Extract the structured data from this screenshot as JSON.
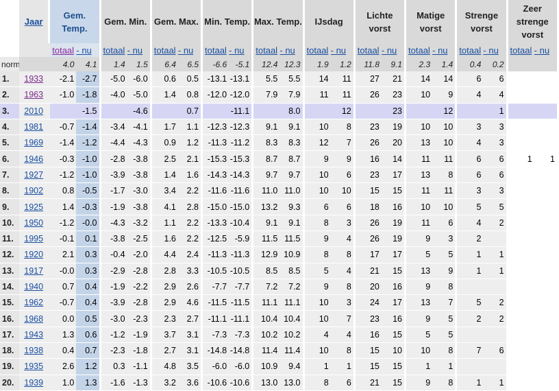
{
  "headers": {
    "jaar": "Jaar",
    "gem_temp": "Gem. Temp.",
    "gem_min": "Gem. Min.",
    "gem_max": "Gem. Max.",
    "min_temp": "Min. Temp.",
    "max_temp": "Max. Temp.",
    "ijsdag": "IJsdag",
    "lichte_vorst": "Lichte vorst",
    "matige_vorst": "Matige vorst",
    "strenge_vorst": "Strenge vorst",
    "zeer_strenge_vorst": "Zeer strenge vorst"
  },
  "subheaders": {
    "totaal": "totaal",
    "nu": "- nu"
  },
  "norm": {
    "label": "norm.",
    "values": [
      "4.0",
      "4.1",
      "1.4",
      "1.5",
      "6.4",
      "6.5",
      "-6.6",
      "-5.1",
      "12.4",
      "12.3",
      "1.9",
      "1.2",
      "11.8",
      "9.1",
      "2.3",
      "1.4",
      "0.4",
      "0.2",
      "",
      ""
    ]
  },
  "rows": [
    {
      "rank": "1.",
      "year": "1933",
      "values": [
        "-2.1",
        "-2.7",
        "-5.0",
        "-6.0",
        "0.6",
        "0.5",
        "-13.1",
        "-13.1",
        "5.5",
        "5.5",
        "14",
        "11",
        "27",
        "21",
        "14",
        "14",
        "6",
        "6",
        "",
        ""
      ]
    },
    {
      "rank": "2.",
      "year": "1963",
      "values": [
        "-1.0",
        "-1.8",
        "-4.0",
        "-5.0",
        "1.4",
        "0.8",
        "-12.0",
        "-12.0",
        "7.9",
        "7.9",
        "11",
        "11",
        "26",
        "23",
        "10",
        "9",
        "4",
        "4",
        "",
        ""
      ]
    },
    {
      "rank": "3.",
      "year": "2010",
      "current": true,
      "values": [
        "",
        "-1.5",
        "",
        "-4.6",
        "",
        "0.7",
        "",
        "-11.1",
        "",
        "8.0",
        "",
        "12",
        "",
        "23",
        "",
        "12",
        "",
        "1",
        "",
        ""
      ]
    },
    {
      "rank": "4.",
      "year": "1981",
      "values": [
        "-0.7",
        "-1.4",
        "-3.4",
        "-4.1",
        "1.7",
        "1.1",
        "-12.3",
        "-12.3",
        "9.1",
        "9.1",
        "10",
        "8",
        "23",
        "19",
        "10",
        "10",
        "3",
        "3",
        "",
        ""
      ]
    },
    {
      "rank": "5.",
      "year": "1969",
      "values": [
        "-1.4",
        "-1.2",
        "-4.4",
        "-4.3",
        "0.9",
        "1.2",
        "-11.3",
        "-11.2",
        "8.3",
        "8.3",
        "12",
        "7",
        "26",
        "20",
        "13",
        "10",
        "4",
        "3",
        "",
        ""
      ]
    },
    {
      "rank": "6.",
      "year": "1946",
      "values": [
        "-0.3",
        "-1.0",
        "-2.8",
        "-3.8",
        "2.5",
        "2.1",
        "-15.3",
        "-15.3",
        "8.7",
        "8.7",
        "9",
        "9",
        "16",
        "14",
        "11",
        "11",
        "6",
        "6",
        "1",
        "1"
      ]
    },
    {
      "rank": "7.",
      "year": "1927",
      "values": [
        "-1.2",
        "-1.0",
        "-3.9",
        "-3.8",
        "1.4",
        "1.6",
        "-14.3",
        "-14.3",
        "9.7",
        "9.7",
        "10",
        "6",
        "23",
        "17",
        "13",
        "8",
        "6",
        "6",
        "",
        ""
      ]
    },
    {
      "rank": "8.",
      "year": "1902",
      "values": [
        "0.8",
        "-0.5",
        "-1.7",
        "-3.0",
        "3.4",
        "2.2",
        "-11.6",
        "-11.6",
        "11.0",
        "11.0",
        "10",
        "10",
        "15",
        "15",
        "11",
        "11",
        "3",
        "3",
        "",
        ""
      ]
    },
    {
      "rank": "9.",
      "year": "1925",
      "values": [
        "1.4",
        "-0.3",
        "-1.9",
        "-3.8",
        "4.1",
        "2.8",
        "-15.0",
        "-15.0",
        "13.2",
        "9.3",
        "6",
        "6",
        "18",
        "16",
        "10",
        "10",
        "5",
        "5",
        "",
        ""
      ]
    },
    {
      "rank": "10.",
      "year": "1950",
      "values": [
        "-1.2",
        "-0.0",
        "-4.3",
        "-3.2",
        "1.1",
        "2.2",
        "-13.3",
        "-10.4",
        "9.1",
        "9.1",
        "8",
        "3",
        "26",
        "19",
        "11",
        "6",
        "4",
        "2",
        "",
        ""
      ]
    },
    {
      "rank": "11.",
      "year": "1995",
      "values": [
        "-0.1",
        "0.1",
        "-3.8",
        "-2.5",
        "1.6",
        "2.2",
        "-12.5",
        "-5.9",
        "11.5",
        "11.5",
        "9",
        "4",
        "26",
        "19",
        "9",
        "3",
        "2",
        "",
        "",
        ""
      ]
    },
    {
      "rank": "12.",
      "year": "1920",
      "values": [
        "2.1",
        "0.3",
        "-0.4",
        "-2.0",
        "4.4",
        "2.4",
        "-11.3",
        "-11.3",
        "12.9",
        "10.9",
        "8",
        "8",
        "17",
        "17",
        "5",
        "5",
        "1",
        "1",
        "",
        ""
      ]
    },
    {
      "rank": "13.",
      "year": "1917",
      "values": [
        "-0.0",
        "0.3",
        "-2.9",
        "-2.8",
        "2.8",
        "3.3",
        "-10.5",
        "-10.5",
        "8.5",
        "8.5",
        "5",
        "4",
        "21",
        "15",
        "13",
        "9",
        "1",
        "1",
        "",
        ""
      ]
    },
    {
      "rank": "14.",
      "year": "1940",
      "values": [
        "0.7",
        "0.4",
        "-1.9",
        "-2.2",
        "2.9",
        "2.6",
        "-7.7",
        "-7.7",
        "7.2",
        "7.2",
        "9",
        "8",
        "20",
        "16",
        "9",
        "8",
        "",
        "",
        "",
        ""
      ]
    },
    {
      "rank": "15.",
      "year": "1962",
      "values": [
        "-0.7",
        "0.4",
        "-3.9",
        "-2.8",
        "2.9",
        "4.6",
        "-11.5",
        "-11.5",
        "11.1",
        "11.1",
        "10",
        "3",
        "24",
        "17",
        "13",
        "7",
        "5",
        "2",
        "",
        ""
      ]
    },
    {
      "rank": "16.",
      "year": "1968",
      "values": [
        "0.0",
        "0.5",
        "-3.0",
        "-2.3",
        "2.3",
        "2.7",
        "-11.1",
        "-11.1",
        "10.4",
        "10.4",
        "10",
        "7",
        "23",
        "16",
        "9",
        "5",
        "2",
        "2",
        "",
        ""
      ]
    },
    {
      "rank": "17.",
      "year": "1943",
      "values": [
        "1.3",
        "0.6",
        "-1.2",
        "-1.9",
        "3.7",
        "3.1",
        "-7.3",
        "-7.3",
        "10.2",
        "10.2",
        "4",
        "4",
        "16",
        "15",
        "5",
        "5",
        "",
        "",
        "",
        ""
      ]
    },
    {
      "rank": "18.",
      "year": "1938",
      "values": [
        "0.4",
        "0.7",
        "-2.3",
        "-1.8",
        "2.7",
        "3.1",
        "-14.8",
        "-14.8",
        "11.4",
        "11.4",
        "10",
        "8",
        "15",
        "10",
        "10",
        "8",
        "7",
        "6",
        "",
        ""
      ]
    },
    {
      "rank": "19.",
      "year": "1935",
      "values": [
        "2.6",
        "1.2",
        "0.3",
        "-1.1",
        "4.8",
        "3.5",
        "-6.0",
        "-6.0",
        "10.9",
        "9.4",
        "1",
        "1",
        "15",
        "15",
        "1",
        "1",
        "",
        "",
        "",
        ""
      ]
    },
    {
      "rank": "20.",
      "year": "1939",
      "values": [
        "1.0",
        "1.3",
        "-1.6",
        "-1.3",
        "3.2",
        "3.6",
        "-10.6",
        "-10.6",
        "13.0",
        "13.0",
        "8",
        "6",
        "21",
        "15",
        "9",
        "8",
        "1",
        "1",
        "",
        ""
      ]
    }
  ],
  "colors": {
    "link": "#1a4fa0",
    "visited": "#7a2a8a",
    "highlight": "#c4d4e8",
    "current_row": "#d6d6f4",
    "header_bg": "#d9d9d9"
  }
}
